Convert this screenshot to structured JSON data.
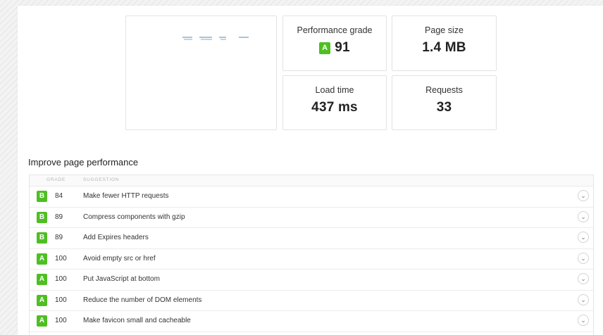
{
  "summary": {
    "performance_grade": {
      "label": "Performance grade",
      "grade": "A",
      "value": "91"
    },
    "page_size": {
      "label": "Page size",
      "value": "1.4 MB"
    },
    "load_time": {
      "label": "Load time",
      "value": "437 ms"
    },
    "requests": {
      "label": "Requests",
      "value": "33"
    }
  },
  "improve": {
    "title": "Improve page performance",
    "columns": {
      "grade": "GRADE",
      "suggestion": "SUGGESTION"
    },
    "rows": [
      {
        "grade": "B",
        "score": "84",
        "suggestion": "Make fewer HTTP requests"
      },
      {
        "grade": "B",
        "score": "89",
        "suggestion": "Compress components with gzip"
      },
      {
        "grade": "B",
        "score": "89",
        "suggestion": "Add Expires headers"
      },
      {
        "grade": "A",
        "score": "100",
        "suggestion": "Avoid empty src or href"
      },
      {
        "grade": "A",
        "score": "100",
        "suggestion": "Put JavaScript at bottom"
      },
      {
        "grade": "A",
        "score": "100",
        "suggestion": "Reduce the number of DOM elements"
      },
      {
        "grade": "A",
        "score": "100",
        "suggestion": "Make favicon small and cacheable"
      }
    ],
    "expand_icon": "chevron-down-icon"
  },
  "colors": {
    "grade_green": "#4ebf22"
  }
}
